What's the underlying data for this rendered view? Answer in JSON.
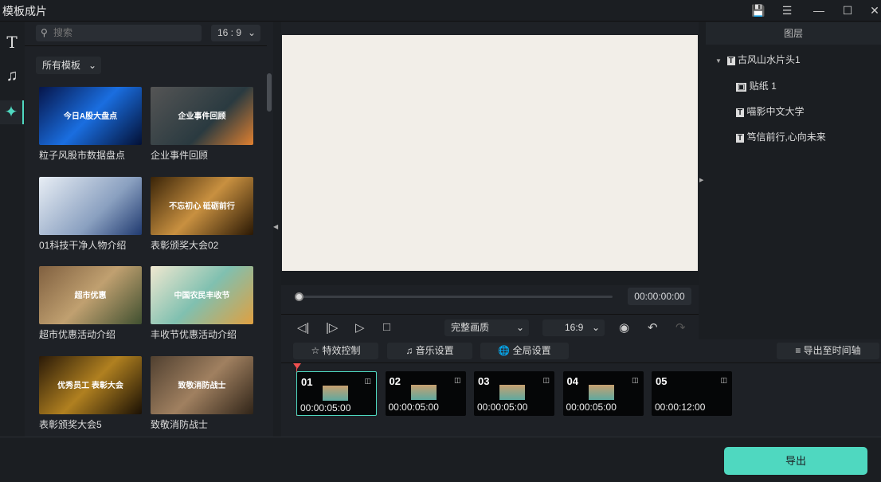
{
  "window": {
    "title": "模板成片",
    "icons": [
      "save-icon",
      "list-icon",
      "minimize-icon",
      "maximize-icon",
      "close-icon"
    ]
  },
  "sidebar": {
    "icons": [
      "text-icon",
      "music-icon",
      "template-icon"
    ]
  },
  "templates": {
    "search_placeholder": "搜索",
    "ratio": "16 : 9",
    "filter": "所有模板",
    "items": [
      {
        "label": "粒子风股市数据盘点",
        "thumb_text": "今日A股大盘点"
      },
      {
        "label": "企业事件回顾",
        "thumb_text": "企业事件回顾"
      },
      {
        "label": "01科技干净人物介绍",
        "thumb_text": ""
      },
      {
        "label": "表彰颁奖大会02",
        "thumb_text": "不忘初心 砥砺前行"
      },
      {
        "label": "超市优惠活动介绍",
        "thumb_text": "超市优惠"
      },
      {
        "label": "丰收节优惠活动介绍",
        "thumb_text": "中国农民丰收节"
      },
      {
        "label": "表彰颁奖大会5",
        "thumb_text": "优秀员工 表彰大会"
      },
      {
        "label": "致敬消防战士",
        "thumb_text": "致敬消防战士"
      }
    ]
  },
  "preview": {
    "time": "00:00:00:00",
    "progress": 0,
    "quality": "完整画质",
    "ratio": "16:9"
  },
  "layers": {
    "title": "图层",
    "root": "古风山水片头1",
    "children": [
      {
        "icon": "sticker-icon",
        "label": "贴纸 1"
      },
      {
        "icon": "text-icon",
        "label": "喵影中文大学"
      },
      {
        "icon": "text-icon",
        "label": "笃信前行,心向未来"
      }
    ]
  },
  "toolbar": {
    "effects": "特效控制",
    "music": "音乐设置",
    "global": "全局设置",
    "export_timeline": "导出至时间轴"
  },
  "clips": [
    {
      "num": "01",
      "dur": "00:00:05:00"
    },
    {
      "num": "02",
      "dur": "00:00:05:00"
    },
    {
      "num": "03",
      "dur": "00:00:05:00"
    },
    {
      "num": "04",
      "dur": "00:00:05:00"
    },
    {
      "num": "05",
      "dur": "00:00:12:00"
    }
  ],
  "export": "导出",
  "colors": {
    "accent": "#4fd8c0",
    "playhead": "#f05050",
    "canvas": "#f2eee8"
  }
}
